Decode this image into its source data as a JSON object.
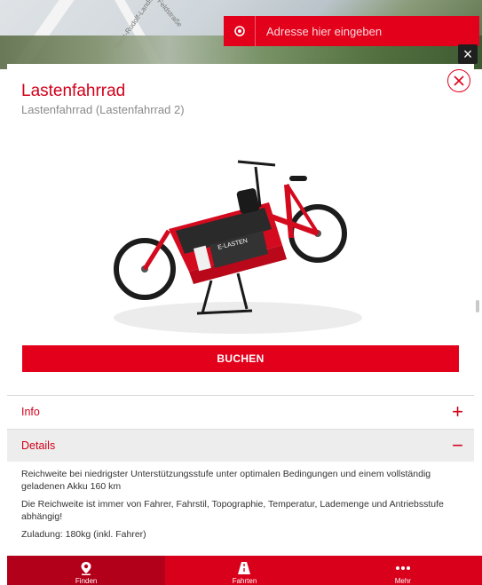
{
  "map": {
    "street_labels": [
      "Hans-Rudolf-Landstraße",
      "Feldstraße"
    ]
  },
  "search": {
    "placeholder": "Adresse hier eingeben",
    "locate_icon": "location-target-icon"
  },
  "panel": {
    "title": "Lastenfahrrad",
    "subtitle": "Lastenfahrrad (Lastenfahrrad 2)",
    "bike_panel_text": "E-LASTEN",
    "book_label": "BUCHEN",
    "info_label": "Info",
    "details_label": "Details",
    "info_toggle": "+",
    "details_toggle": "−",
    "details_paragraphs": [
      "Reichweite bei niedrigster Unterstützungsstufe unter optimalen Bedingungen und einem vollständig geladenen Akku 160 km",
      "Die Reichweite ist immer von Fahrer, Fahrstil, Topographie, Temperatur, Lademenge und Antriebsstufe abhängig!",
      "Zuladung: 180kg (inkl. Fahrer)"
    ]
  },
  "nav": {
    "items": [
      {
        "label": "Finden",
        "icon": "map-pin-icon",
        "active": true
      },
      {
        "label": "Fahrten",
        "icon": "road-icon",
        "active": false
      },
      {
        "label": "Mehr",
        "icon": "more-dots-icon",
        "active": false
      }
    ]
  },
  "colors": {
    "brand_red": "#e3001b",
    "title_red": "#d2001a",
    "nav_active": "#b3001a"
  }
}
